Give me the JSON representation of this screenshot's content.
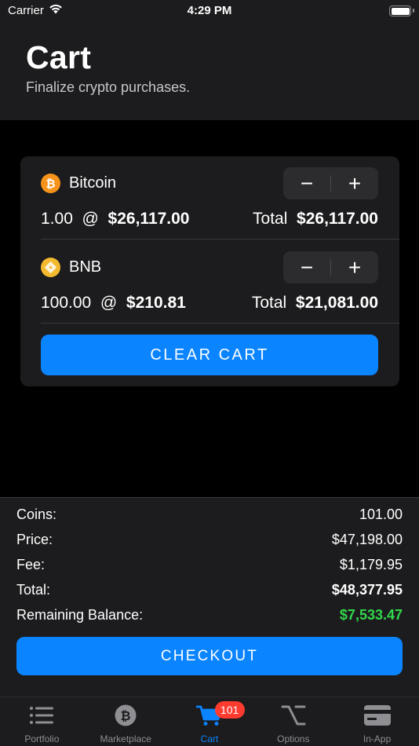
{
  "status_bar": {
    "carrier": "Carrier",
    "time": "4:29 PM"
  },
  "header": {
    "title": "Cart",
    "subtitle": "Finalize crypto purchases."
  },
  "cart": {
    "items": [
      {
        "name": "Bitcoin",
        "icon": "bitcoin-icon",
        "icon_color": "#f7931a",
        "quantity": "1.00",
        "at": "@",
        "price": "$26,117.00",
        "total_label": "Total",
        "total": "$26,117.00",
        "minus": "−",
        "plus": "+"
      },
      {
        "name": "BNB",
        "icon": "bnb-icon",
        "icon_color": "#f3ba2f",
        "quantity": "100.00",
        "at": "@",
        "price": "$210.81",
        "total_label": "Total",
        "total": "$21,081.00",
        "minus": "−",
        "plus": "+"
      }
    ],
    "clear_label": "CLEAR CART"
  },
  "summary": {
    "rows": [
      {
        "label": "Coins:",
        "value": "101.00"
      },
      {
        "label": "Price:",
        "value": "$47,198.00"
      },
      {
        "label": "Fee:",
        "value": "$1,179.95"
      },
      {
        "label": "Total:",
        "value": "$48,377.95"
      },
      {
        "label": "Remaining Balance:",
        "value": "$7,533.47"
      }
    ],
    "checkout_label": "CHECKOUT"
  },
  "tabs": [
    {
      "label": "Portfolio",
      "icon": "list-icon"
    },
    {
      "label": "Marketplace",
      "icon": "bitcoin-circle-icon"
    },
    {
      "label": "Cart",
      "icon": "cart-icon",
      "badge": "101",
      "active": true
    },
    {
      "label": "Options",
      "icon": "option-key-icon"
    },
    {
      "label": "In-App",
      "icon": "credit-card-icon"
    }
  ],
  "colors": {
    "accent": "#0a84ff",
    "positive": "#32d74b",
    "badge": "#ff3b30"
  }
}
